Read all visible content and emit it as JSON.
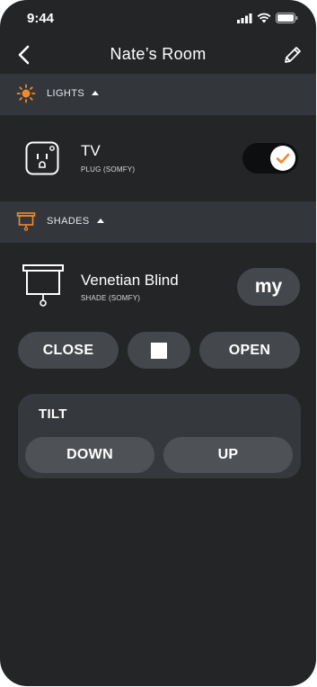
{
  "status": {
    "time": "9:44"
  },
  "nav": {
    "title": "Nate’s Room"
  },
  "sections": {
    "lights": {
      "label": "LIGHTS"
    },
    "shades": {
      "label": "SHADES"
    }
  },
  "devices": {
    "tv": {
      "name": "TV",
      "subtitle": "PLUG (SOMFY)",
      "toggle_on": true
    },
    "blind": {
      "name": "Venetian Blind",
      "subtitle": "SHADE (SOMFY)",
      "my_label": "my"
    }
  },
  "controls": {
    "close_label": "CLOSE",
    "open_label": "OPEN"
  },
  "tilt": {
    "label": "TILT",
    "down_label": "DOWN",
    "up_label": "UP"
  },
  "colors": {
    "accent": "#f08a2c",
    "background": "#232527",
    "section_bar": "#33373b",
    "button": "#44484d"
  }
}
